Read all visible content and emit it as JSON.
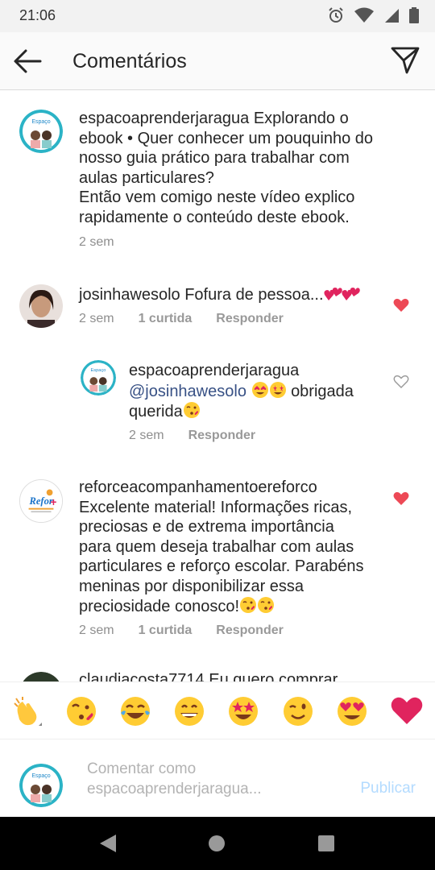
{
  "status_bar": {
    "time": "21:06",
    "icons": [
      "alarm-icon",
      "wifi-icon",
      "signal-icon",
      "battery-icon"
    ]
  },
  "header": {
    "title": "Comentários",
    "back_icon": "arrow-left-icon",
    "send_icon": "paper-plane-icon"
  },
  "caption": {
    "username": "espacoaprenderjaragua",
    "text_lines": [
      "Explorando o",
      "ebook • Quer conhecer um pouquinho do",
      "nosso guia prático para trabalhar com",
      "aulas particulares?",
      "Então vem comigo neste vídeo explico",
      "rapidamente o conteúdo deste ebook."
    ],
    "time": "2 sem"
  },
  "comments": [
    {
      "username": "josinhawesolo",
      "text": "Fofura de pessoa...",
      "emojis": [
        "two-hearts",
        "two-hearts"
      ],
      "time": "2 sem",
      "likes": "1 curtida",
      "reply_label": "Responder",
      "liked": true
    },
    {
      "username": "espacoaprenderjaragua",
      "mention": "@josinhawesolo",
      "text_after": "obrigada",
      "text_line2": "querida",
      "emojis": [
        "heart-eyes",
        "star-struck"
      ],
      "emoji_end": "kissing-heart",
      "time": "2 sem",
      "reply_label": "Responder",
      "liked": false
    },
    {
      "username": "reforceacompanhamentoereforco",
      "text_lines": [
        "Excelente material! Informações ricas,",
        "preciosas e de extrema importância",
        "para quem deseja trabalhar com aulas",
        "particulares e reforço escolar. Parabéns",
        "meninas por disponibilizar essa",
        "preciosidade conosco!"
      ],
      "emojis": [
        "kissing-heart",
        "kissing-heart"
      ],
      "time": "2 sem",
      "likes": "1 curtida",
      "reply_label": "Responder",
      "liked": true
    },
    {
      "username": "claudiacosta7714",
      "text": "Eu quero comprar"
    }
  ],
  "emoji_bar": [
    "clapping-hands",
    "kissing-heart",
    "tears-of-joy",
    "grinning",
    "star-struck",
    "winking",
    "heart-eyes",
    "red-heart"
  ],
  "composer": {
    "placeholder_line1": "Comentar como",
    "placeholder_line2": "espacoaprenderjaragua...",
    "publish_label": "Publicar"
  },
  "nav": [
    "back-triangle-icon",
    "home-circle-icon",
    "recents-square-icon"
  ],
  "colors": {
    "heart_red": "#ed4956",
    "link_blue": "#385185",
    "publish_disabled": "#b3dbff",
    "meta_gray": "#8e8e8e"
  }
}
